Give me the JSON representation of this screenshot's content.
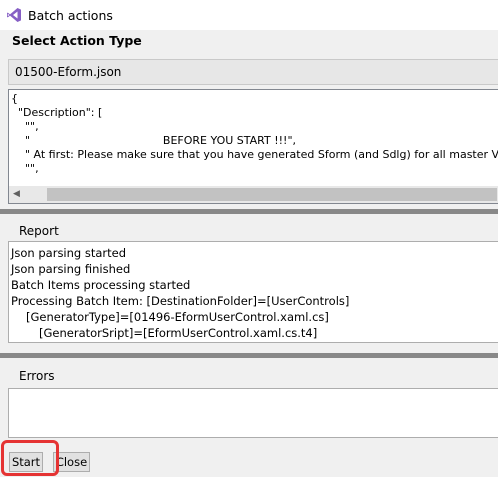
{
  "window": {
    "title": "Batch actions",
    "icon": "visual-studio-icon"
  },
  "action_section": {
    "label": "Select Action Type",
    "selected_file": "01500-Eform.json"
  },
  "json_preview": {
    "lines": [
      "{",
      "  \"Description\": [",
      "    \"\",",
      "    \"                                      BEFORE YOU START !!!\",",
      "    \" At first: Please make sure that you have generated Sform (and Sdlg) for all master Views",
      "    \"\","
    ]
  },
  "report": {
    "label": "Report",
    "lines": [
      "Json parsing started",
      "Json parsing finished",
      "Batch Items processing started",
      "Processing Batch Item: [DestinationFolder]=[UserControls]",
      "[GeneratorType]=[01496-EformUserControl.xaml.cs]",
      "[GeneratorSript]=[EformUserControl.xaml.cs.t4]"
    ]
  },
  "errors": {
    "label": "Errors",
    "value": ""
  },
  "buttons": {
    "start": "Start",
    "close": "Close"
  },
  "colors": {
    "highlight": "#e53333",
    "vs_purple": "#865fc5"
  }
}
